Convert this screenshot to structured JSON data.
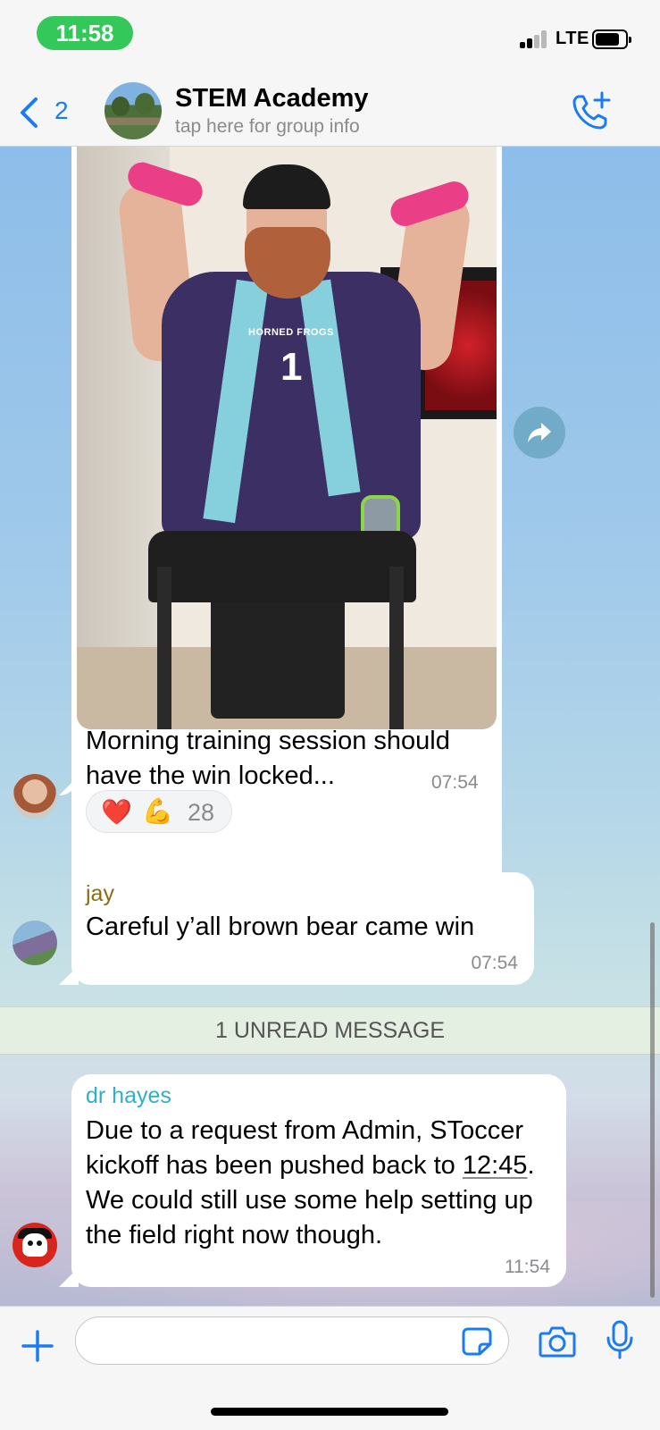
{
  "status_bar": {
    "time": "11:58",
    "network": "LTE"
  },
  "nav": {
    "back_count": "2",
    "title": "STEM Academy",
    "subtitle": "tap here for group info",
    "accent_color": "#1b7cf2"
  },
  "messages": {
    "photo_post": {
      "caption": "Morning training session should have the win locked...",
      "time": "07:54",
      "shirt_text": "HORNED FROGS",
      "shirt_number": "1",
      "reactions": {
        "emoji_1": "❤️",
        "emoji_2": "💪",
        "count": "28"
      }
    },
    "jay": {
      "sender": "jay",
      "text": "Careful y’all brown bear came win",
      "time": "07:54",
      "sender_color": "#8a6d10"
    },
    "unread_banner": "1 UNREAD MESSAGE",
    "hayes": {
      "sender": "dr hayes",
      "text_part1": "Due to a request from Admin, SToccer kickoff has been pushed back to ",
      "text_time_link": "12:45",
      "text_part2": ". We could still use some help setting up the field right now though.",
      "time": "11:54",
      "sender_color": "#2fb0c8"
    }
  },
  "input": {
    "value": "",
    "placeholder": ""
  },
  "icons": {
    "back": "chevron-left-icon",
    "call": "add-call-icon",
    "forward": "share-arrow-icon",
    "add": "plus-icon",
    "sticker": "sticker-icon",
    "camera": "camera-icon",
    "mic": "microphone-icon"
  }
}
